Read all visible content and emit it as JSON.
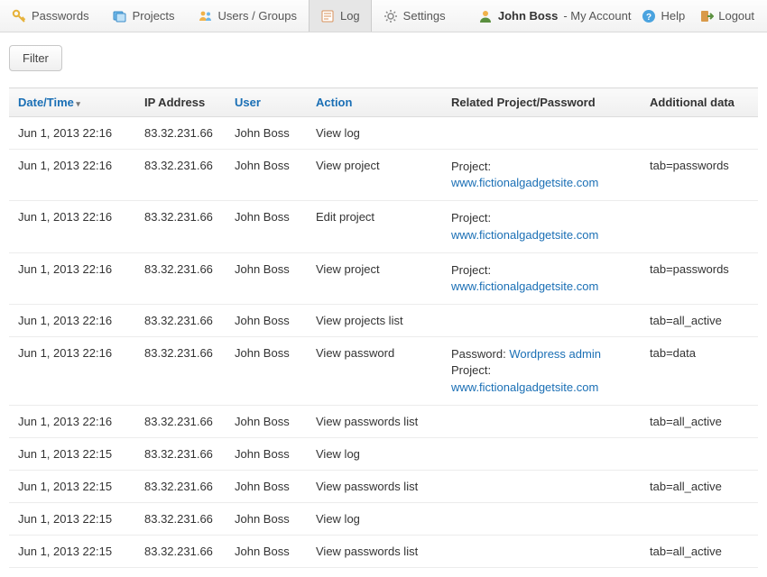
{
  "nav": {
    "items": [
      {
        "id": "passwords",
        "label": "Passwords"
      },
      {
        "id": "projects",
        "label": "Projects"
      },
      {
        "id": "users",
        "label": "Users / Groups"
      },
      {
        "id": "log",
        "label": "Log",
        "active": true
      },
      {
        "id": "settings",
        "label": "Settings"
      }
    ],
    "user_name": "John Boss",
    "account_label": " - My Account",
    "help_label": "Help",
    "logout_label": "Logout"
  },
  "toolbar": {
    "filter_label": "Filter"
  },
  "table": {
    "headers": {
      "datetime": "Date/Time",
      "ip": "IP Address",
      "user": "User",
      "action": "Action",
      "related": "Related Project/Password",
      "additional": "Additional data"
    },
    "related_labels": {
      "project": "Project: ",
      "password": "Password: "
    },
    "rows": [
      {
        "datetime": "Jun 1, 2013 22:16",
        "ip": "83.32.231.66",
        "user": "John Boss",
        "action": "View log",
        "related": [],
        "additional": ""
      },
      {
        "datetime": "Jun 1, 2013 22:16",
        "ip": "83.32.231.66",
        "user": "John Boss",
        "action": "View project",
        "related": [
          {
            "type": "project",
            "link": "www.fictionalgadgetsite.com"
          }
        ],
        "additional": "tab=passwords"
      },
      {
        "datetime": "Jun 1, 2013 22:16",
        "ip": "83.32.231.66",
        "user": "John Boss",
        "action": "Edit project",
        "related": [
          {
            "type": "project",
            "link": "www.fictionalgadgetsite.com"
          }
        ],
        "additional": ""
      },
      {
        "datetime": "Jun 1, 2013 22:16",
        "ip": "83.32.231.66",
        "user": "John Boss",
        "action": "View project",
        "related": [
          {
            "type": "project",
            "link": "www.fictionalgadgetsite.com"
          }
        ],
        "additional": "tab=passwords"
      },
      {
        "datetime": "Jun 1, 2013 22:16",
        "ip": "83.32.231.66",
        "user": "John Boss",
        "action": "View projects list",
        "related": [],
        "additional": "tab=all_active"
      },
      {
        "datetime": "Jun 1, 2013 22:16",
        "ip": "83.32.231.66",
        "user": "John Boss",
        "action": "View password",
        "related": [
          {
            "type": "password",
            "link": "Wordpress admin"
          },
          {
            "type": "project",
            "link": "www.fictionalgadgetsite.com"
          }
        ],
        "additional": "tab=data"
      },
      {
        "datetime": "Jun 1, 2013 22:16",
        "ip": "83.32.231.66",
        "user": "John Boss",
        "action": "View passwords list",
        "related": [],
        "additional": "tab=all_active"
      },
      {
        "datetime": "Jun 1, 2013 22:15",
        "ip": "83.32.231.66",
        "user": "John Boss",
        "action": "View log",
        "related": [],
        "additional": ""
      },
      {
        "datetime": "Jun 1, 2013 22:15",
        "ip": "83.32.231.66",
        "user": "John Boss",
        "action": "View passwords list",
        "related": [],
        "additional": "tab=all_active"
      },
      {
        "datetime": "Jun 1, 2013 22:15",
        "ip": "83.32.231.66",
        "user": "John Boss",
        "action": "View log",
        "related": [],
        "additional": ""
      },
      {
        "datetime": "Jun 1, 2013 22:15",
        "ip": "83.32.231.66",
        "user": "John Boss",
        "action": "View passwords list",
        "related": [],
        "additional": "tab=all_active"
      }
    ]
  }
}
